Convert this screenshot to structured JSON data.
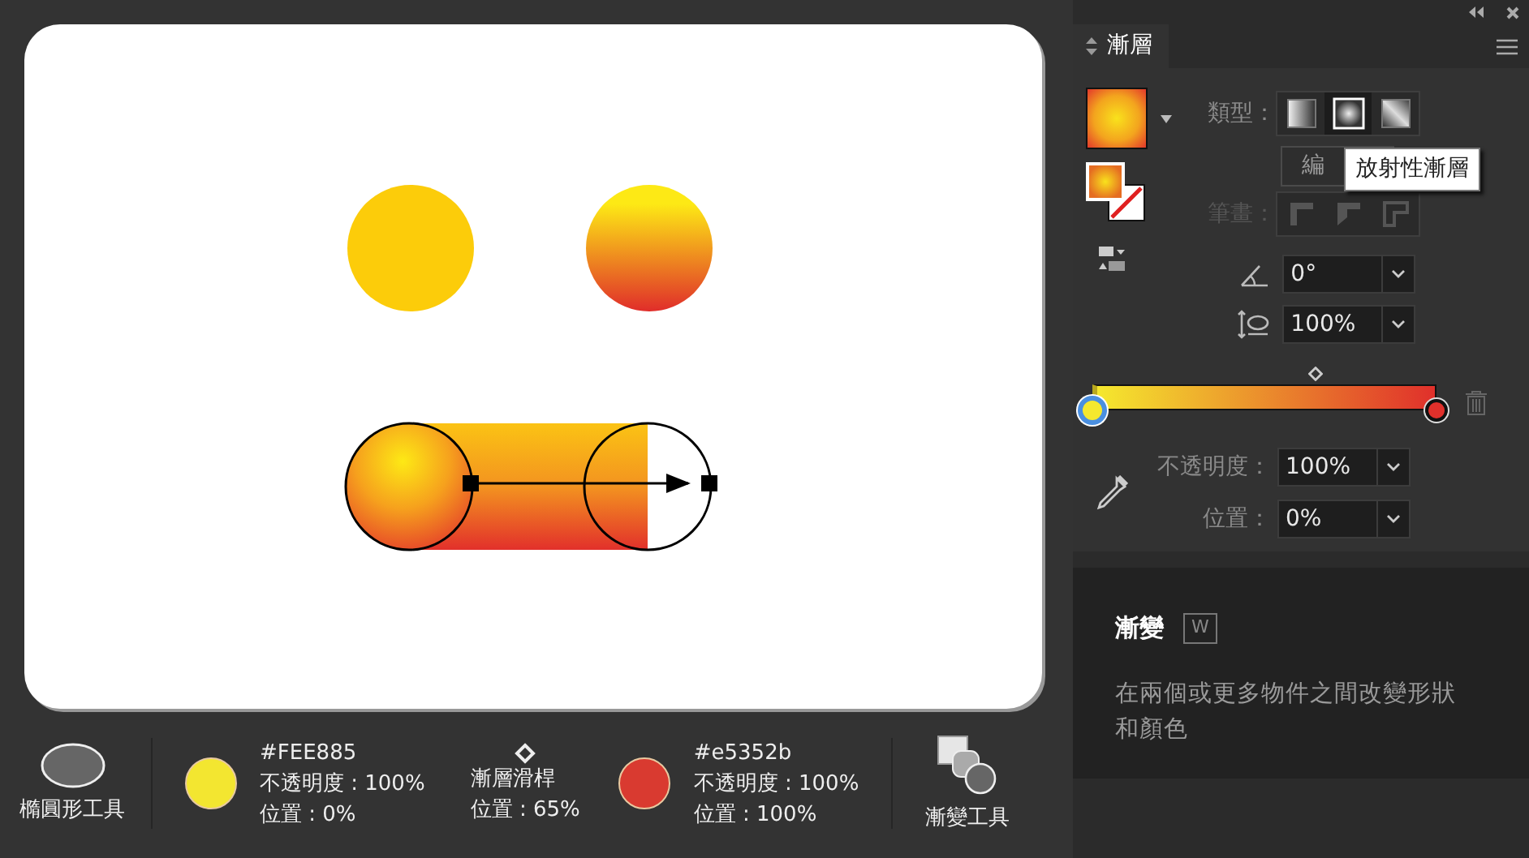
{
  "panel": {
    "tab": {
      "label": "漸層",
      "selected": true
    },
    "type": {
      "label": "類型：",
      "options": [
        {
          "kind": "linear",
          "selected": false
        },
        {
          "kind": "radial",
          "selected": true
        },
        {
          "kind": "freeform",
          "selected": false
        }
      ]
    },
    "edit_button": {
      "label": "編"
    },
    "tooltip": "放射性漸層",
    "stroke": {
      "label": "筆畫：",
      "disabled": true,
      "options": [
        {
          "kind": "within"
        },
        {
          "kind": "along"
        },
        {
          "kind": "across"
        }
      ]
    },
    "angle": {
      "value": "0°"
    },
    "aspect_ratio": {
      "value": "100%"
    },
    "gradient_slider": {
      "stops": [
        {
          "color": "#f5e82e",
          "selected": true
        },
        {
          "color": "#e0302b",
          "selected": false
        }
      ]
    },
    "opacity": {
      "label": "不透明度：",
      "value": "100%"
    },
    "location": {
      "label": "位置：",
      "value": "0%"
    }
  },
  "info": {
    "title": "漸變",
    "shortcut": "W",
    "description": "在兩個或更多物件之間改變形狀和顏色"
  },
  "legend": [
    {
      "kind": "ellipse_tool",
      "label": "橢圓形工具"
    },
    {
      "kind": "stop",
      "color": "#f3e630",
      "hex": "#FEE885",
      "opacity": "不透明度 : 100%",
      "position": "位置 : 0%"
    },
    {
      "kind": "midpoint",
      "label": "漸層滑桿",
      "position": "位置 : 65%"
    },
    {
      "kind": "stop",
      "color": "#d93a30",
      "hex": "#e5352b",
      "opacity": "不透明度 : 100%",
      "position": "位置 : 100%"
    },
    {
      "kind": "gradient_tool",
      "label": "漸變工具"
    }
  ]
}
